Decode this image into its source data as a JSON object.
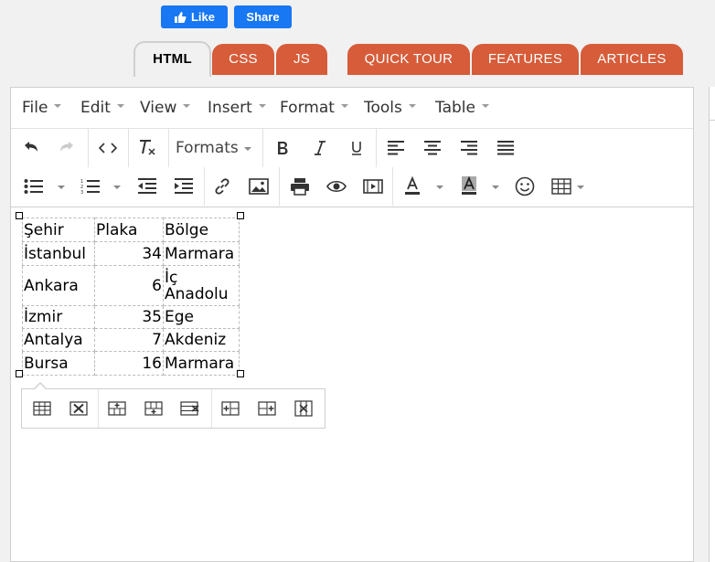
{
  "social": {
    "like_label": "Like",
    "share_label": "Share"
  },
  "tabs": [
    {
      "label": "HTML",
      "active": true
    },
    {
      "label": "CSS",
      "active": false
    },
    {
      "label": "JS",
      "active": false
    },
    {
      "label": "QUICK TOUR",
      "active": false
    },
    {
      "label": "FEATURES",
      "active": false
    },
    {
      "label": "ARTICLES",
      "active": false
    }
  ],
  "menubar": [
    "File",
    "Edit",
    "View",
    "Insert",
    "Format",
    "Tools",
    "Table"
  ],
  "toolbar": {
    "formats_label": "Formats",
    "row1_icons": [
      "undo-icon",
      "redo-icon",
      "source-code-icon",
      "clear-formatting-icon",
      "bold-icon",
      "italic-icon",
      "underline-icon",
      "align-left-icon",
      "align-center-icon",
      "align-right-icon",
      "align-justify-icon"
    ],
    "row2_icons": [
      "bullet-list-icon",
      "numbered-list-icon",
      "outdent-icon",
      "indent-icon",
      "link-icon",
      "image-icon",
      "print-icon",
      "preview-icon",
      "media-icon",
      "text-color-icon",
      "background-color-icon",
      "emoticons-icon",
      "table-icon"
    ]
  },
  "table": {
    "rows": [
      [
        "Şehir",
        "Plaka",
        "Bölge"
      ],
      [
        "İstanbul",
        "34",
        "Marmara"
      ],
      [
        "Ankara",
        "6",
        "İç Anadolu"
      ],
      [
        "İzmir",
        "35",
        "Ege"
      ],
      [
        "Antalya",
        "7",
        "Akdeniz"
      ],
      [
        "Bursa",
        "16",
        "Marmara"
      ]
    ]
  },
  "table_toolbar": {
    "icons": [
      "table-properties-icon",
      "delete-table-icon",
      "insert-row-before-icon",
      "insert-row-after-icon",
      "delete-row-icon",
      "insert-column-before-icon",
      "insert-column-after-icon",
      "delete-column-icon"
    ]
  },
  "colors": {
    "accent": "#d65c3a",
    "facebook": "#1877f2"
  }
}
